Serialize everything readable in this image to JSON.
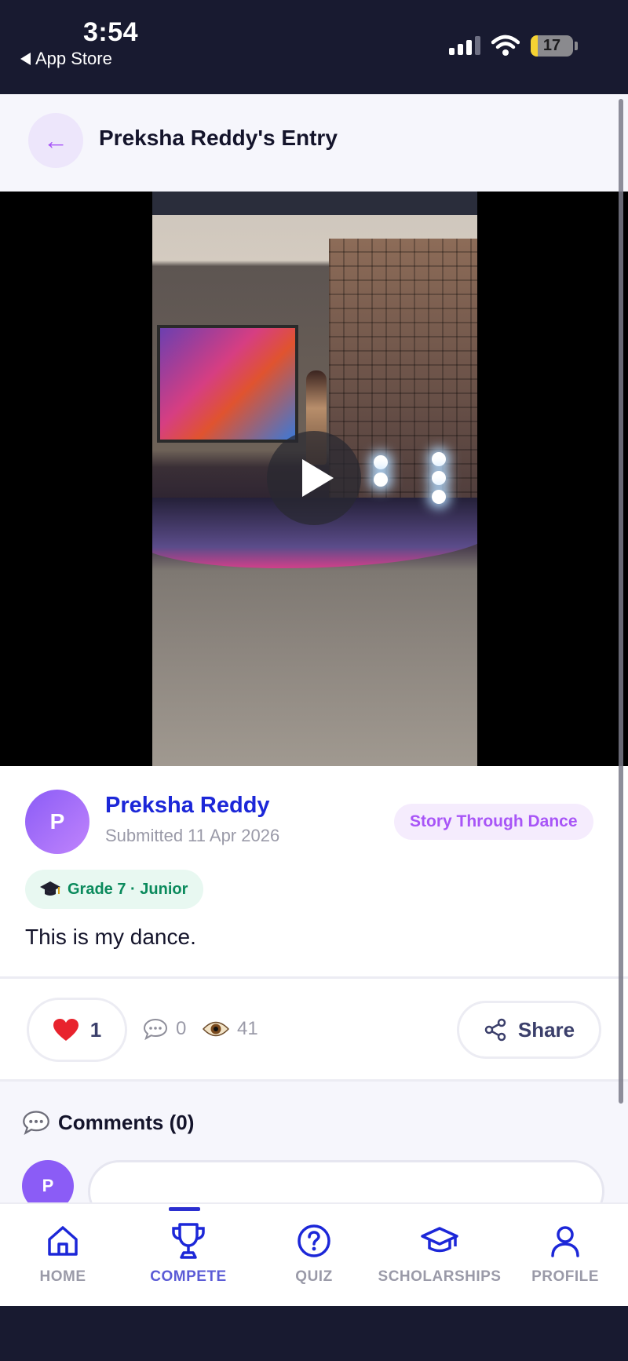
{
  "status_bar": {
    "time": "3:54",
    "back_app": "App Store",
    "battery": "17",
    "battery_level": 0.17
  },
  "header": {
    "back_icon": "arrow-left-icon",
    "title": "Preksha Reddy's Entry"
  },
  "video": {
    "play_icon": "play-icon"
  },
  "entry": {
    "avatar_initial": "P",
    "author_name": "Preksha Reddy",
    "submitted": "Submitted 11 Apr 2026",
    "category": "Story Through Dance",
    "grade_icon": "graduation-cap-icon",
    "grade": "Grade 7 · Junior",
    "description": "This is my dance."
  },
  "actions": {
    "like_icon": "heart-icon",
    "likes": "1",
    "comments_icon": "speech-bubble-icon",
    "comments": "0",
    "views_icon": "eye-icon",
    "views": "41",
    "share_icon": "share-icon",
    "share_label": "Share"
  },
  "comments": {
    "heading_icon": "speech-bubble-icon",
    "heading": "Comments (0)",
    "avatar_initial": "P"
  },
  "nav": {
    "items": [
      {
        "label": "HOME",
        "icon": "home-icon"
      },
      {
        "label": "COMPETE",
        "icon": "trophy-icon",
        "active": true
      },
      {
        "label": "QUIZ",
        "icon": "question-circle-icon"
      },
      {
        "label": "SCHOLARSHIPS",
        "icon": "graduation-cap-icon"
      },
      {
        "label": "PROFILE",
        "icon": "user-icon"
      }
    ]
  },
  "colors": {
    "brand_blue": "#1c27d8",
    "accent_purple": "#a855f7",
    "grade_green": "#0a8a5c",
    "status_bg": "#181a30"
  }
}
